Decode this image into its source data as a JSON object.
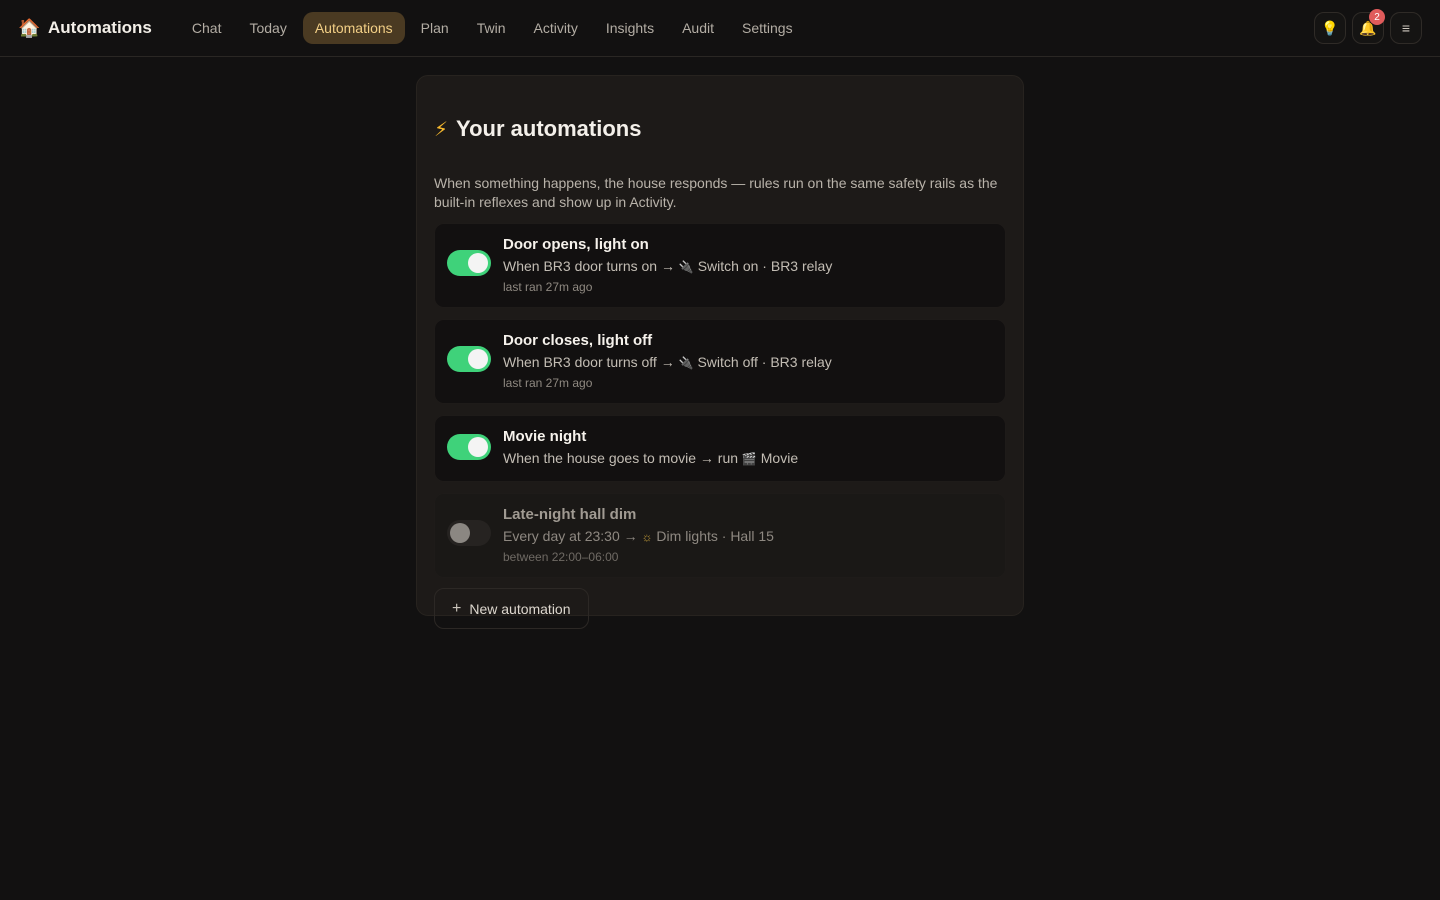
{
  "header": {
    "title": "Automations",
    "nav": [
      {
        "label": "Chat",
        "active": false
      },
      {
        "label": "Today",
        "active": false
      },
      {
        "label": "Automations",
        "active": true
      },
      {
        "label": "Plan",
        "active": false
      },
      {
        "label": "Twin",
        "active": false
      },
      {
        "label": "Activity",
        "active": false
      },
      {
        "label": "Insights",
        "active": false
      },
      {
        "label": "Audit",
        "active": false
      },
      {
        "label": "Settings",
        "active": false
      }
    ],
    "notifications_count": "2"
  },
  "panel": {
    "title": "Your automations",
    "description": "When something happens, the house responds — rules run on the same safety rails as the built-in reflexes and show up in Activity.",
    "rules": [
      {
        "name": "Door opens, light on",
        "trigger": "When BR3 door turns on →",
        "action": "Switch on · BR3 relay",
        "meta": "last ran 27m ago",
        "enabled": true
      },
      {
        "name": "Door closes, light off",
        "trigger": "When BR3 door turns off →",
        "action": "Switch off · BR3 relay",
        "meta": "last ran 27m ago",
        "enabled": true
      },
      {
        "name": "Movie night",
        "trigger": "When the house goes to movie → run",
        "action": "Movie",
        "meta": "",
        "enabled": true
      },
      {
        "name": "Late-night hall dim",
        "trigger": "Every day at 23:30 →",
        "action": "Dim lights · Hall 15",
        "meta": "between 22:00–06:00",
        "enabled": false
      }
    ],
    "new_button": "New automation"
  },
  "colors": {
    "accent": "#f2cf86",
    "toggle_on": "#3fd27a",
    "badge": "#e05b5b"
  }
}
